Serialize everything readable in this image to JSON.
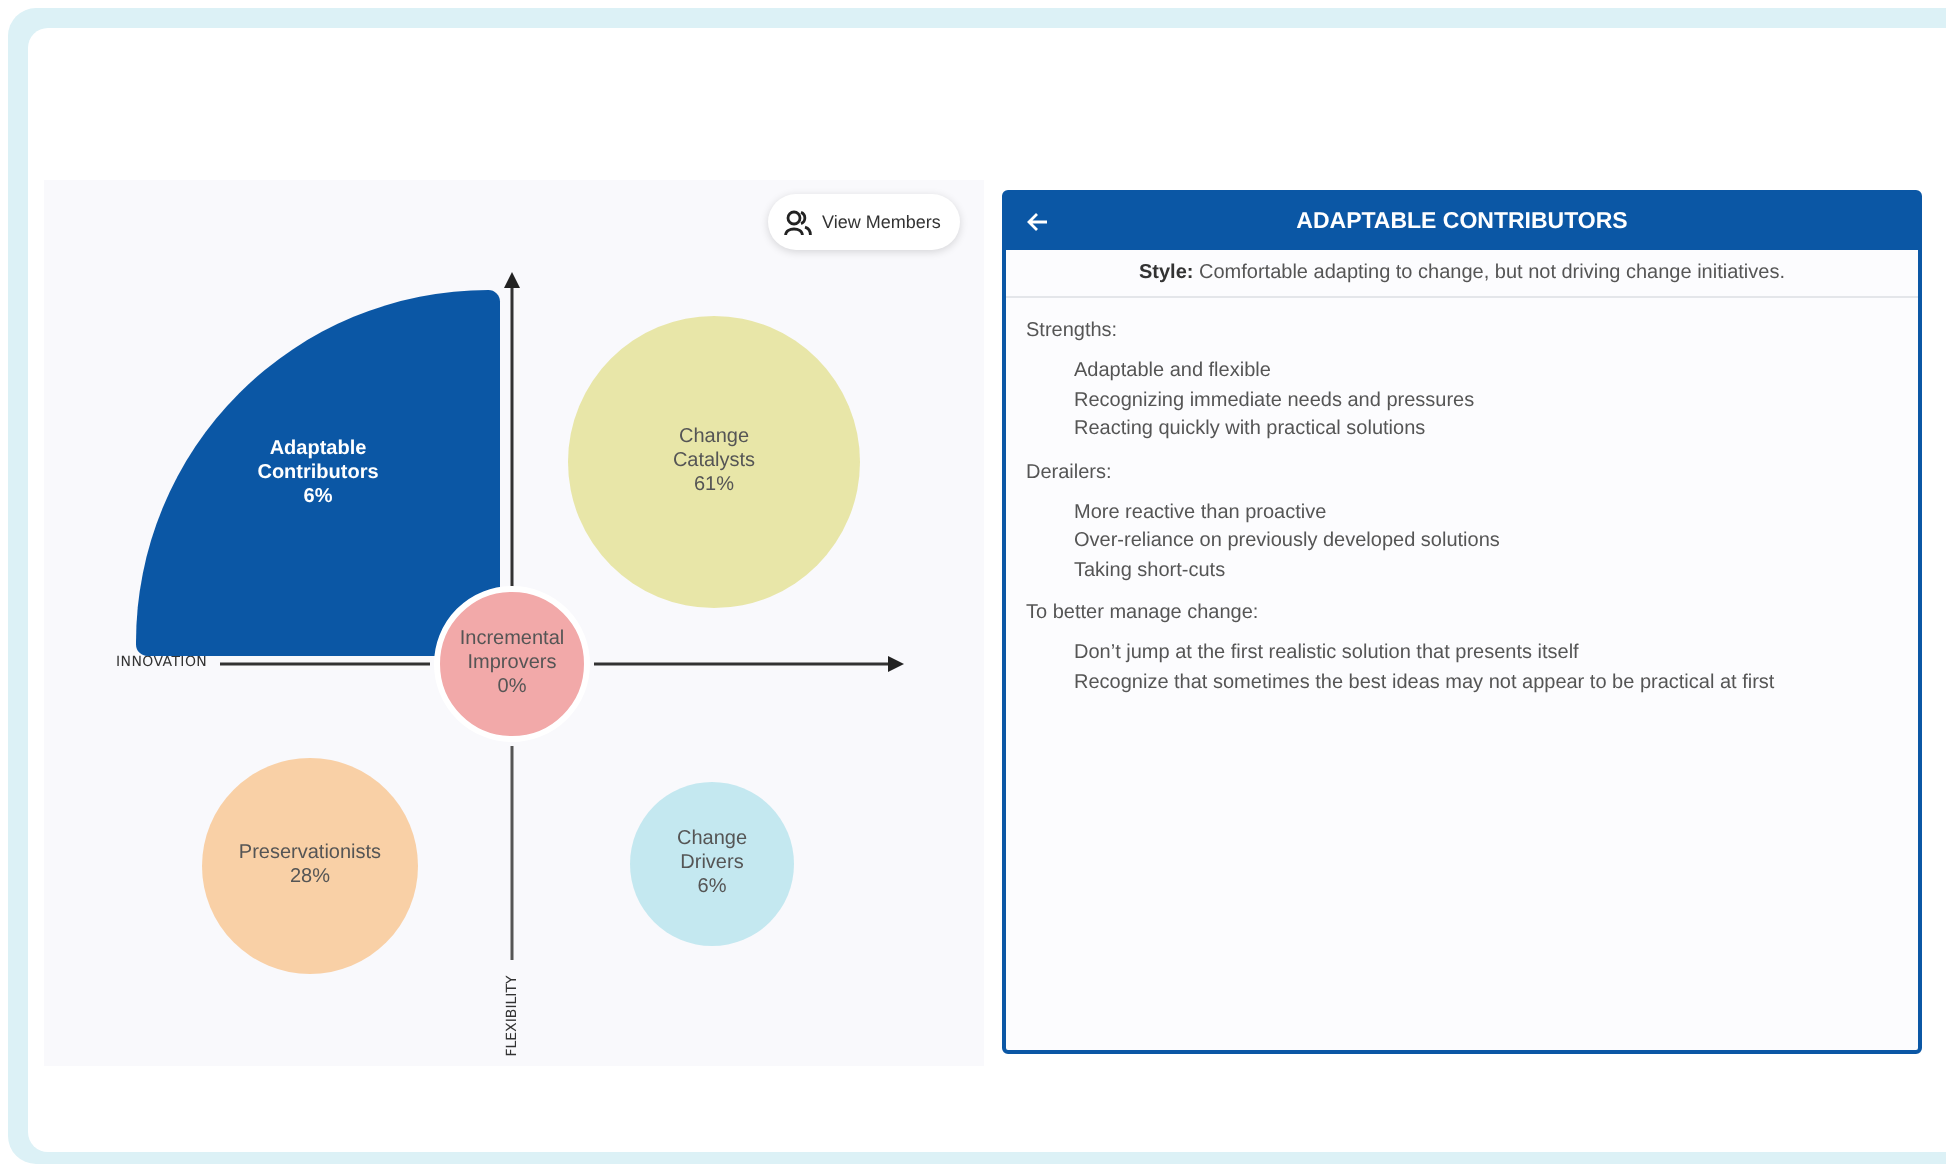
{
  "chart": {
    "view_members": "View Members",
    "x_axis_label": "INNOVATION",
    "y_axis_label": "FLEXIBILITY",
    "segments": [
      {
        "kind": "quarter",
        "label": "Adaptable Contributors",
        "percent": "6%",
        "color": "#0b57a5",
        "selected": true
      },
      {
        "kind": "top-right",
        "label": "Change Catalysts",
        "percent": "61%",
        "color": "#e8e6a8",
        "selected": false
      },
      {
        "kind": "center",
        "label": "Incremental Improvers",
        "percent": "0%",
        "color": "#f2a9a9",
        "selected": false
      },
      {
        "kind": "bottom-left",
        "label": "Preservationists",
        "percent": "28%",
        "color": "#f9d0a6",
        "selected": false
      },
      {
        "kind": "bottom-right",
        "label": "Change Drivers",
        "percent": "6%",
        "color": "#c4e8f0",
        "selected": false
      }
    ]
  },
  "panel": {
    "title": "ADAPTABLE CONTRIBUTORS",
    "style": "**Style:** Comfortable adapting to change, but not driving change initiatives.",
    "sections": [
      {
        "heading": "Strengths:",
        "items": [
          "Adaptable and flexible",
          "Recognizing immediate needs and pressures",
          "Reacting quickly with practical solutions"
        ]
      },
      {
        "heading": "Derailers:",
        "items": [
          "More reactive than proactive",
          "Over-reliance on previously developed solutions",
          "Taking short-cuts"
        ]
      },
      {
        "heading": "To better manage change:",
        "items": [
          "Don’t jump at the first realistic solution that presents itself",
          "Recognize that sometimes the best ideas may not appear to be practical at first"
        ]
      }
    ]
  }
}
